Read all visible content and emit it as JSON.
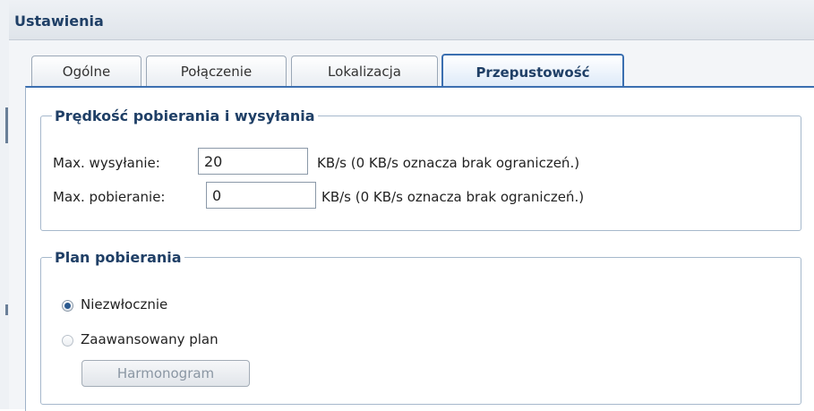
{
  "window": {
    "title": "Ustawienia"
  },
  "tabs": [
    {
      "label": "Ogólne"
    },
    {
      "label": "Połączenie"
    },
    {
      "label": "Lokalizacja"
    },
    {
      "label": "Przepustowość"
    }
  ],
  "speed_group": {
    "legend": "Prędkość pobierania i wysyłania",
    "upload_label": "Max. wysyłanie:",
    "upload_value": "20",
    "upload_hint": "KB/s (0 KB/s oznacza brak ograniczeń.)",
    "download_label": "Max. pobieranie:",
    "download_value": "0",
    "download_hint": "KB/s (0 KB/s oznacza brak ograniczeń.)"
  },
  "schedule_group": {
    "legend": "Plan pobierania",
    "option_immediate": "Niezwłocznie",
    "option_advanced": "Zaawansowany plan",
    "schedule_button": "Harmonogram"
  }
}
